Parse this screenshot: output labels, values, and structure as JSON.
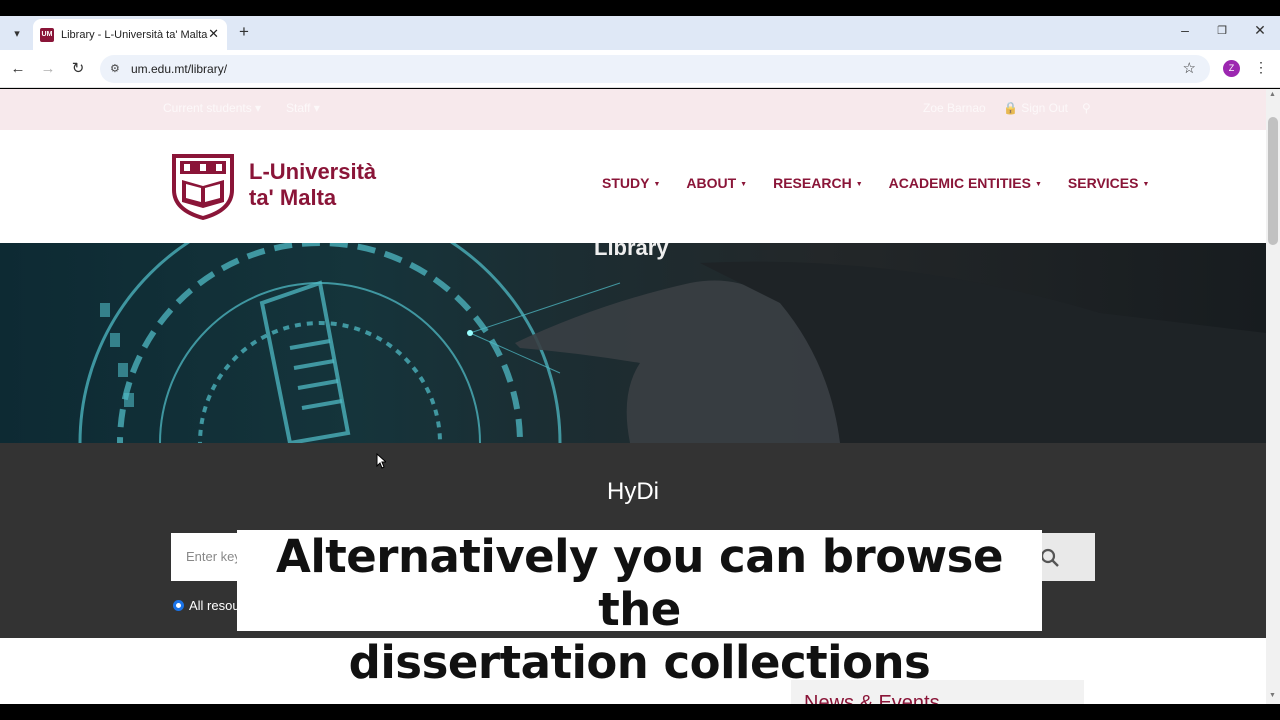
{
  "browser": {
    "tab": {
      "favicon_text": "UM",
      "title": "Library - L-Università ta' Malta"
    },
    "address": {
      "url": "um.edu.mt/library/"
    },
    "profile_initial": "Z"
  },
  "utility_bar": {
    "left_links": [
      "Current students",
      "Staff"
    ],
    "user_name": "Zoe Barnao",
    "sign_out": "Sign Out"
  },
  "header": {
    "logo_line1": "L-Università",
    "logo_line2": "ta' Malta",
    "nav": [
      "STUDY",
      "ABOUT",
      "RESEARCH",
      "ACADEMIC ENTITIES",
      "SERVICES"
    ]
  },
  "hero": {
    "title": "Library"
  },
  "hydi": {
    "title": "HyDi",
    "search_placeholder": "Enter keywords",
    "radio_label": "All resources"
  },
  "content": {
    "news_title": "News & Events"
  },
  "caption": {
    "line1": "Alternatively you can browse the",
    "line2": "dissertation collections"
  },
  "colors": {
    "brand": "#8a1538",
    "hydi_bg": "#333333",
    "utility_bg": "#f7e9ec"
  }
}
